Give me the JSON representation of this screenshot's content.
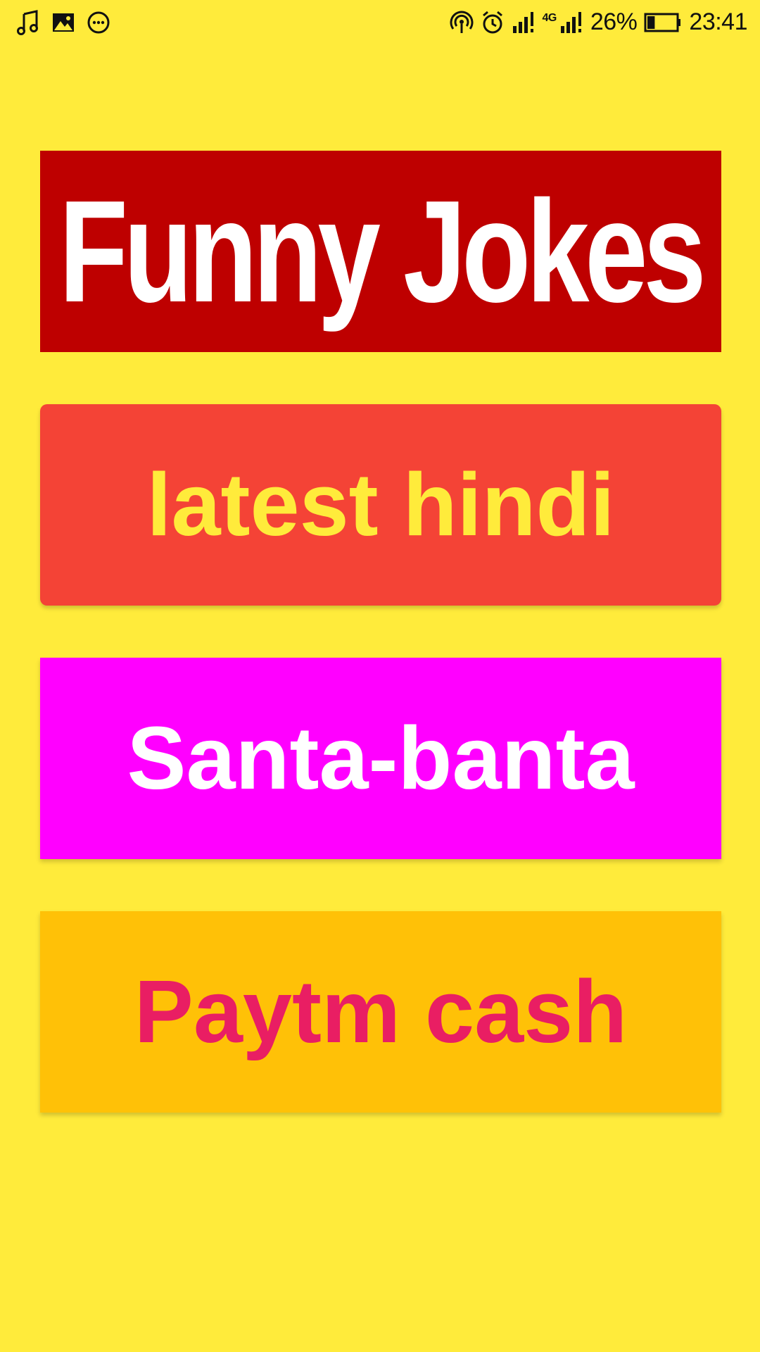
{
  "status_bar": {
    "battery_percent": "26%",
    "time": "23:41",
    "network_label": "4G",
    "left_icons": [
      "music-icon",
      "image-icon",
      "chat-icon"
    ],
    "right_icons": [
      "hotspot-icon",
      "alarm-icon",
      "signal-icon",
      "signal-4g-icon",
      "battery-icon"
    ],
    "battery_level": 0.26
  },
  "header": {
    "title": "Funny Jokes"
  },
  "menu": {
    "latest_hindi": "latest hindi",
    "santa_banta": "Santa-banta",
    "paytm_cash": "Paytm cash"
  },
  "colors": {
    "background": "#FFEB3B",
    "title_banner": "#BE0000",
    "latest_bg": "#F44336",
    "latest_text": "#FFEB3B",
    "santa_bg": "#FF00FF",
    "santa_text": "#FFFFFF",
    "paytm_bg": "#FFC107",
    "paytm_text": "#E91E63"
  }
}
